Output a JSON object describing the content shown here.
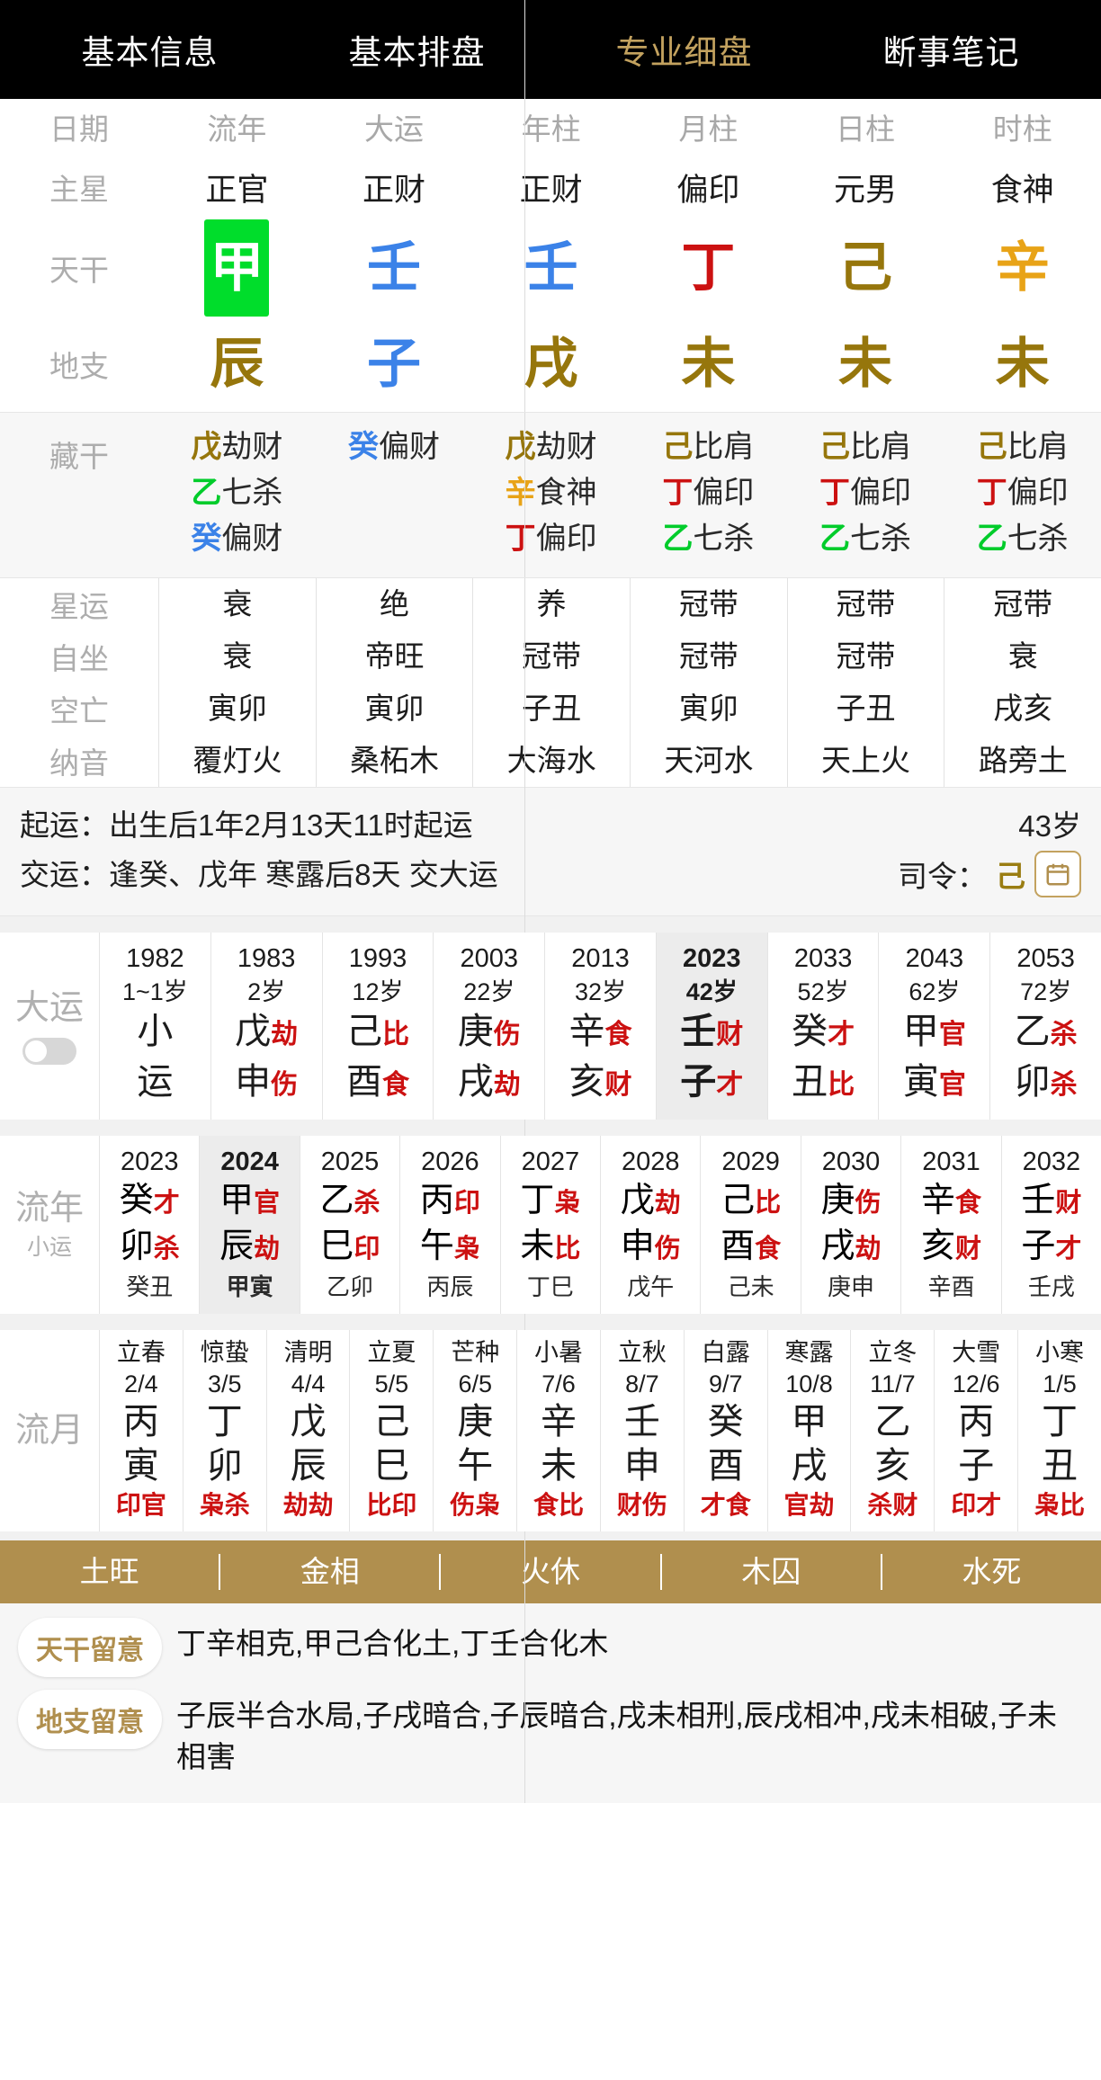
{
  "nav": {
    "tabs": [
      {
        "label": "基本信息",
        "active": false
      },
      {
        "label": "基本排盘",
        "active": false
      },
      {
        "label": "专业细盘",
        "active": true
      },
      {
        "label": "断事笔记",
        "active": false
      }
    ],
    "active_color": "#c3a25f"
  },
  "pillars": {
    "row_labels": {
      "header": "日期",
      "main_star": "主星",
      "heavenly": "天干",
      "earthly": "地支",
      "hidden": "藏干",
      "star_luck": "星运",
      "self_sit": "自坐",
      "void": "空亡",
      "nayin": "纳音"
    },
    "columns": [
      {
        "header": "流年",
        "main_star": "正官",
        "stem": "甲",
        "stem_color": "wood",
        "stem_boxed": true,
        "branch": "辰",
        "branch_color": "earth",
        "hidden": [
          {
            "stem": "戊",
            "color": "earth",
            "god": "劫财"
          },
          {
            "stem": "乙",
            "color": "wood",
            "god": "七杀"
          },
          {
            "stem": "癸",
            "color": "water",
            "god": "偏财"
          }
        ],
        "star_luck": "衰",
        "self_sit": "衰",
        "void": "寅卯",
        "nayin": "覆灯火"
      },
      {
        "header": "大运",
        "main_star": "正财",
        "stem": "壬",
        "stem_color": "water",
        "stem_boxed": false,
        "branch": "子",
        "branch_color": "water",
        "hidden": [
          {
            "stem": "癸",
            "color": "water",
            "god": "偏财"
          }
        ],
        "star_luck": "绝",
        "self_sit": "帝旺",
        "void": "寅卯",
        "nayin": "桑柘木"
      },
      {
        "header": "年柱",
        "main_star": "正财",
        "stem": "壬",
        "stem_color": "water",
        "stem_boxed": false,
        "branch": "戌",
        "branch_color": "earth",
        "hidden": [
          {
            "stem": "戊",
            "color": "earth",
            "god": "劫财"
          },
          {
            "stem": "辛",
            "color": "metal",
            "god": "食神"
          },
          {
            "stem": "丁",
            "color": "fire",
            "god": "偏印"
          }
        ],
        "star_luck": "养",
        "self_sit": "冠带",
        "void": "子丑",
        "nayin": "大海水"
      },
      {
        "header": "月柱",
        "main_star": "偏印",
        "stem": "丁",
        "stem_color": "fire",
        "stem_boxed": false,
        "branch": "未",
        "branch_color": "earth",
        "hidden": [
          {
            "stem": "己",
            "color": "earth",
            "god": "比肩"
          },
          {
            "stem": "丁",
            "color": "fire",
            "god": "偏印"
          },
          {
            "stem": "乙",
            "color": "wood",
            "god": "七杀"
          }
        ],
        "star_luck": "冠带",
        "self_sit": "冠带",
        "void": "寅卯",
        "nayin": "天河水"
      },
      {
        "header": "日柱",
        "main_star": "元男",
        "stem": "己",
        "stem_color": "earth",
        "stem_boxed": false,
        "branch": "未",
        "branch_color": "earth",
        "hidden": [
          {
            "stem": "己",
            "color": "earth",
            "god": "比肩"
          },
          {
            "stem": "丁",
            "color": "fire",
            "god": "偏印"
          },
          {
            "stem": "乙",
            "color": "wood",
            "god": "七杀"
          }
        ],
        "star_luck": "冠带",
        "self_sit": "冠带",
        "void": "子丑",
        "nayin": "天上火"
      },
      {
        "header": "时柱",
        "main_star": "食神",
        "stem": "辛",
        "stem_color": "metal",
        "stem_boxed": false,
        "branch": "未",
        "branch_color": "earth",
        "hidden": [
          {
            "stem": "己",
            "color": "earth",
            "god": "比肩"
          },
          {
            "stem": "丁",
            "color": "fire",
            "god": "偏印"
          },
          {
            "stem": "乙",
            "color": "wood",
            "god": "七杀"
          }
        ],
        "star_luck": "冠带",
        "self_sit": "衰",
        "void": "戌亥",
        "nayin": "路旁土"
      }
    ]
  },
  "luck_info": {
    "qiyun_label": "起运：",
    "qiyun_text": "出生后1年2月13天11时起运",
    "jiaoyun_label": "交运：",
    "jiaoyun_text": "逢癸、戊年 寒露后8天 交大运",
    "age": "43岁",
    "siling_label": "司令：",
    "siling_value": "己",
    "calendar_icon": "calendar-icon"
  },
  "dayun": {
    "label": "大运",
    "toggle_label": "xiaoyun-toggle",
    "columns": [
      {
        "year": "1982",
        "age": "1~1岁",
        "stem": "小",
        "stem_god": "",
        "branch": "运",
        "branch_god": "",
        "selected": false
      },
      {
        "year": "1983",
        "age": "2岁",
        "stem": "戊",
        "stem_god": "劫",
        "branch": "申",
        "branch_god": "伤",
        "selected": false
      },
      {
        "year": "1993",
        "age": "12岁",
        "stem": "己",
        "stem_god": "比",
        "branch": "酉",
        "branch_god": "食",
        "selected": false
      },
      {
        "year": "2003",
        "age": "22岁",
        "stem": "庚",
        "stem_god": "伤",
        "branch": "戌",
        "branch_god": "劫",
        "selected": false
      },
      {
        "year": "2013",
        "age": "32岁",
        "stem": "辛",
        "stem_god": "食",
        "branch": "亥",
        "branch_god": "财",
        "selected": false
      },
      {
        "year": "2023",
        "age": "42岁",
        "stem": "壬",
        "stem_god": "财",
        "branch": "子",
        "branch_god": "才",
        "selected": true
      },
      {
        "year": "2033",
        "age": "52岁",
        "stem": "癸",
        "stem_god": "才",
        "branch": "丑",
        "branch_god": "比",
        "selected": false
      },
      {
        "year": "2043",
        "age": "62岁",
        "stem": "甲",
        "stem_god": "官",
        "branch": "寅",
        "branch_god": "官",
        "selected": false
      },
      {
        "year": "2053",
        "age": "72岁",
        "stem": "乙",
        "stem_god": "杀",
        "branch": "卯",
        "branch_god": "杀",
        "selected": false
      }
    ]
  },
  "liunian": {
    "label": "流年",
    "sublabel": "小运",
    "columns": [
      {
        "year": "2023",
        "stem": "癸",
        "stem_god": "才",
        "branch": "卯",
        "branch_god": "杀",
        "sub": "癸丑",
        "selected": false
      },
      {
        "year": "2024",
        "stem": "甲",
        "stem_god": "官",
        "branch": "辰",
        "branch_god": "劫",
        "sub": "甲寅",
        "selected": true
      },
      {
        "year": "2025",
        "stem": "乙",
        "stem_god": "杀",
        "branch": "巳",
        "branch_god": "印",
        "sub": "乙卯",
        "selected": false
      },
      {
        "year": "2026",
        "stem": "丙",
        "stem_god": "印",
        "branch": "午",
        "branch_god": "枭",
        "sub": "丙辰",
        "selected": false
      },
      {
        "year": "2027",
        "stem": "丁",
        "stem_god": "枭",
        "branch": "未",
        "branch_god": "比",
        "sub": "丁巳",
        "selected": false
      },
      {
        "year": "2028",
        "stem": "戊",
        "stem_god": "劫",
        "branch": "申",
        "branch_god": "伤",
        "sub": "戊午",
        "selected": false
      },
      {
        "year": "2029",
        "stem": "己",
        "stem_god": "比",
        "branch": "酉",
        "branch_god": "食",
        "sub": "己未",
        "selected": false
      },
      {
        "year": "2030",
        "stem": "庚",
        "stem_god": "伤",
        "branch": "戌",
        "branch_god": "劫",
        "sub": "庚申",
        "selected": false
      },
      {
        "year": "2031",
        "stem": "辛",
        "stem_god": "食",
        "branch": "亥",
        "branch_god": "财",
        "sub": "辛酉",
        "selected": false
      },
      {
        "year": "2032",
        "stem": "壬",
        "stem_god": "财",
        "branch": "子",
        "branch_god": "才",
        "sub": "壬戌",
        "selected": false
      }
    ]
  },
  "liuyue": {
    "label": "流月",
    "columns": [
      {
        "jieqi": "立春",
        "date": "2/4",
        "stem": "丙",
        "branch": "寅",
        "gods": "印官"
      },
      {
        "jieqi": "惊蛰",
        "date": "3/5",
        "stem": "丁",
        "branch": "卯",
        "gods": "枭杀"
      },
      {
        "jieqi": "清明",
        "date": "4/4",
        "stem": "戊",
        "branch": "辰",
        "gods": "劫劫"
      },
      {
        "jieqi": "立夏",
        "date": "5/5",
        "stem": "己",
        "branch": "巳",
        "gods": "比印"
      },
      {
        "jieqi": "芒种",
        "date": "6/5",
        "stem": "庚",
        "branch": "午",
        "gods": "伤枭"
      },
      {
        "jieqi": "小暑",
        "date": "7/6",
        "stem": "辛",
        "branch": "未",
        "gods": "食比"
      },
      {
        "jieqi": "立秋",
        "date": "8/7",
        "stem": "壬",
        "branch": "申",
        "gods": "财伤"
      },
      {
        "jieqi": "白露",
        "date": "9/7",
        "stem": "癸",
        "branch": "酉",
        "gods": "才食"
      },
      {
        "jieqi": "寒露",
        "date": "10/8",
        "stem": "甲",
        "branch": "戌",
        "gods": "官劫"
      },
      {
        "jieqi": "立冬",
        "date": "11/7",
        "stem": "乙",
        "branch": "亥",
        "gods": "杀财"
      },
      {
        "jieqi": "大雪",
        "date": "12/6",
        "stem": "丙",
        "branch": "子",
        "gods": "印才"
      },
      {
        "jieqi": "小寒",
        "date": "1/5",
        "stem": "丁",
        "branch": "丑",
        "gods": "枭比"
      }
    ]
  },
  "wuxing_bar": {
    "bg_color": "#b08f4e",
    "items": [
      "土旺",
      "金相",
      "火休",
      "木囚",
      "水死"
    ]
  },
  "notes": [
    {
      "chip": "天干留意",
      "text": "丁辛相克,甲己合化土,丁壬合化木"
    },
    {
      "chip": "地支留意",
      "text": "子辰半合水局,子戌暗合,子辰暗合,戌未相刑,辰戌相冲,戌未相破,子未相害"
    }
  ]
}
